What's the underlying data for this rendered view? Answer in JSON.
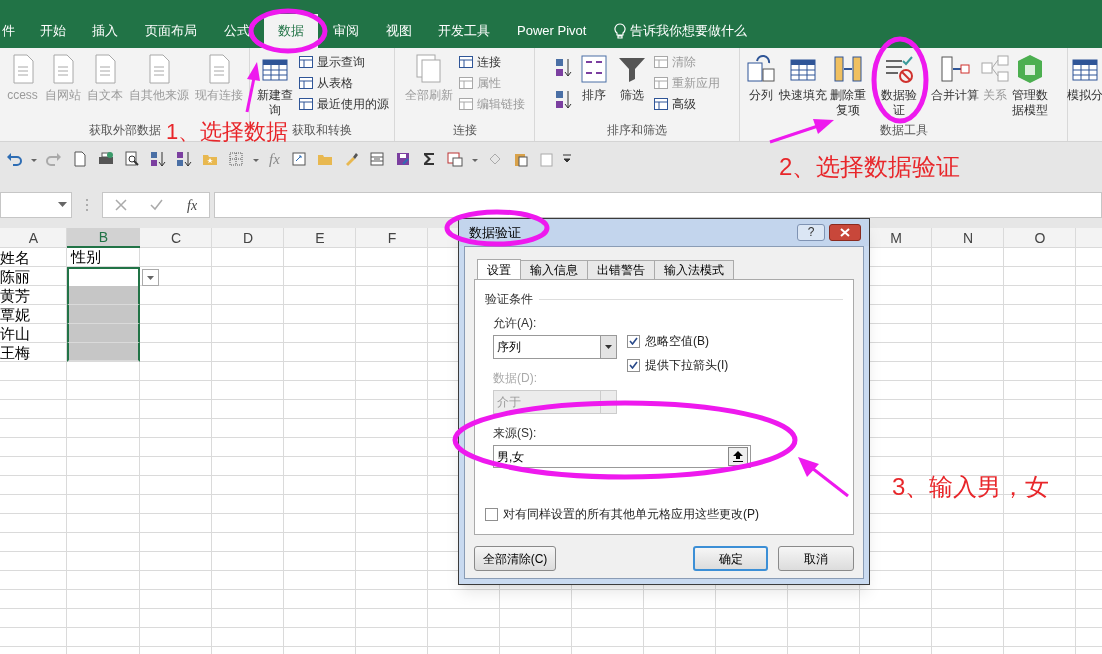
{
  "ribbon_tabs": [
    {
      "label": "件",
      "selected": false
    },
    {
      "label": "开始",
      "selected": false
    },
    {
      "label": "插入",
      "selected": false
    },
    {
      "label": "页面布局",
      "selected": false
    },
    {
      "label": "公式",
      "selected": false
    },
    {
      "label": "数据",
      "selected": true
    },
    {
      "label": "审阅",
      "selected": false
    },
    {
      "label": "视图",
      "selected": false
    },
    {
      "label": "开发工具",
      "selected": false
    },
    {
      "label": "Power Pivot",
      "selected": false
    }
  ],
  "tell_me": "告诉我你想要做什么",
  "ribbon_groups": [
    {
      "title": "获取外部数据",
      "items": [
        {
          "kind": "large",
          "label": "ccess",
          "disabled": true
        },
        {
          "kind": "large",
          "label": "自网站",
          "disabled": true
        },
        {
          "kind": "large",
          "label": "自文本",
          "disabled": true
        },
        {
          "kind": "large",
          "label": "自其他来源",
          "disabled": true
        },
        {
          "kind": "large",
          "label": "现有连接",
          "disabled": true
        }
      ]
    },
    {
      "title": "获取和转换",
      "items": [
        {
          "kind": "large",
          "label": "新建查询",
          "disabled": false
        },
        {
          "kind": "stack",
          "entries": [
            {
              "label": "显示查询",
              "disabled": false
            },
            {
              "label": "从表格",
              "disabled": false
            },
            {
              "label": "最近使用的源",
              "disabled": false
            }
          ]
        }
      ]
    },
    {
      "title": "连接",
      "items": [
        {
          "kind": "large",
          "label": "全部刷新",
          "disabled": true
        },
        {
          "kind": "stack",
          "entries": [
            {
              "label": "连接",
              "disabled": false
            },
            {
              "label": "属性",
              "disabled": true
            },
            {
              "label": "编辑链接",
              "disabled": true
            }
          ]
        }
      ]
    },
    {
      "title": "排序和筛选",
      "items": [
        {
          "kind": "sort_icons"
        },
        {
          "kind": "large",
          "label": "排序",
          "disabled": false
        },
        {
          "kind": "large",
          "label": "筛选",
          "disabled": false
        },
        {
          "kind": "stack",
          "entries": [
            {
              "label": "清除",
              "disabled": true
            },
            {
              "label": "重新应用",
              "disabled": true
            },
            {
              "label": "高级",
              "disabled": false
            }
          ]
        }
      ]
    },
    {
      "title": "数据工具",
      "items": [
        {
          "kind": "large",
          "label": "分列",
          "disabled": false
        },
        {
          "kind": "large",
          "label": "快速填充",
          "disabled": false
        },
        {
          "kind": "large",
          "label": "删除重复项",
          "disabled": false
        },
        {
          "kind": "large",
          "label": "数据验证",
          "disabled": false
        },
        {
          "kind": "large",
          "label": "合并计算",
          "disabled": false
        },
        {
          "kind": "large",
          "label": "关系",
          "disabled": true
        },
        {
          "kind": "large",
          "label": "管理数据模型",
          "disabled": false
        }
      ]
    },
    {
      "items": [
        {
          "kind": "large",
          "label": "模拟分",
          "disabled": false
        }
      ]
    }
  ],
  "quick_access_fx": "fx",
  "formula_bar": {
    "fx": "fx"
  },
  "sheet": {
    "columns": [
      {
        "label": "A",
        "selected": false
      },
      {
        "label": "B",
        "selected": true
      },
      {
        "label": "C",
        "selected": false
      },
      {
        "label": "D",
        "selected": false
      },
      {
        "label": "E",
        "selected": false
      },
      {
        "label": "F",
        "selected": false
      },
      {
        "label": "M",
        "selected": false
      },
      {
        "label": "N",
        "selected": false
      },
      {
        "label": "O",
        "selected": false
      }
    ],
    "rows": [
      {
        "a": "姓名",
        "b": "性别",
        "b_selected": false
      },
      {
        "a": "陈丽",
        "b_selected": true,
        "b_active": true,
        "dropdown": true
      },
      {
        "a": "黄芳",
        "b_selected": true,
        "b_active": false
      },
      {
        "a": "覃妮",
        "b_selected": true,
        "b_active": false
      },
      {
        "a": "许山",
        "b_selected": true,
        "b_active": false
      },
      {
        "a": "王梅",
        "b_selected": true,
        "b_active": false
      }
    ]
  },
  "dialog": {
    "title": "数据验证",
    "help": "?",
    "tabs": [
      {
        "label": "设置",
        "selected": true
      },
      {
        "label": "输入信息",
        "selected": false
      },
      {
        "label": "出错警告",
        "selected": false
      },
      {
        "label": "输入法模式",
        "selected": false
      }
    ],
    "section_title": "验证条件",
    "allow": {
      "label": "允许(A):",
      "value": "序列"
    },
    "options": [
      {
        "label": "忽略空值(B)",
        "checked": true
      },
      {
        "label": "提供下拉箭头(I)",
        "checked": true
      }
    ],
    "data": {
      "label": "数据(D):",
      "value": "介于",
      "disabled": true
    },
    "source": {
      "label": "来源(S):",
      "value": "男,女"
    },
    "apply_all": {
      "label": "对有同样设置的所有其他单元格应用这些更改(P)",
      "checked": false
    },
    "buttons": [
      {
        "label": "全部清除(C)",
        "kind": "normal"
      },
      {
        "label": "确定",
        "kind": "default"
      },
      {
        "label": "取消",
        "kind": "normal"
      }
    ]
  },
  "annotations": [
    {
      "text": "1、选择数据"
    },
    {
      "text": "2、选择数据验证"
    },
    {
      "text": "3、输入男，女"
    }
  ]
}
